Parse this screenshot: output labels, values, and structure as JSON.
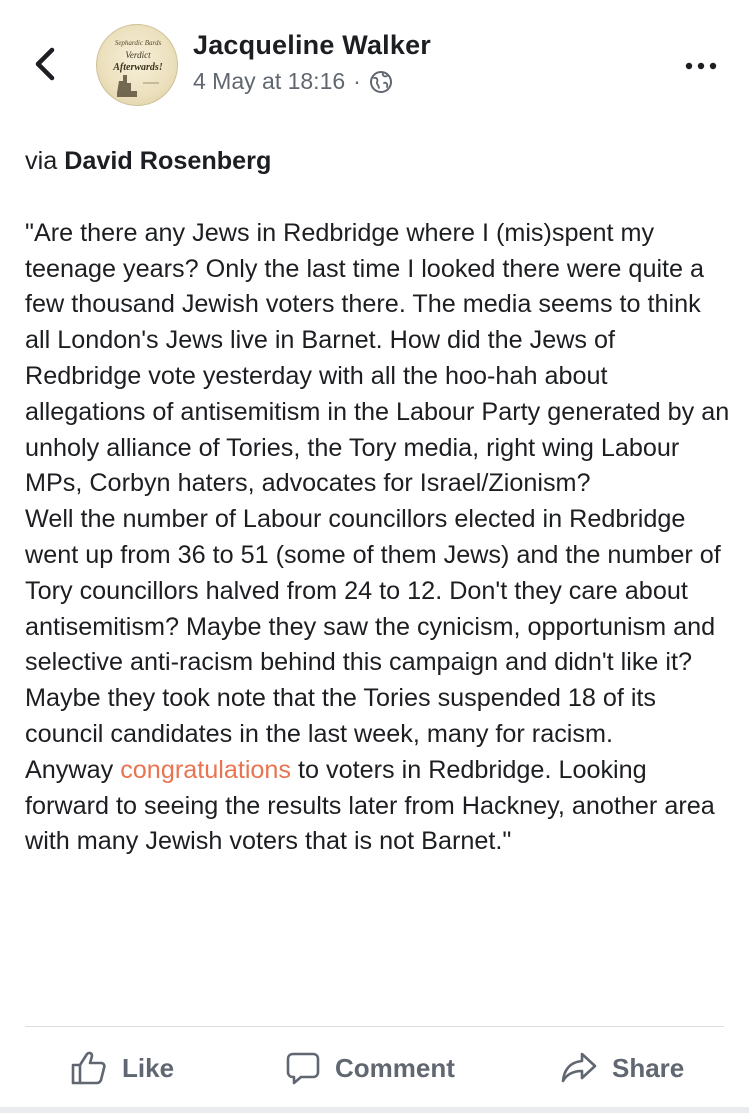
{
  "header": {
    "author": "Jacqueline Walker",
    "timestamp": "4 May at 18:16",
    "separator": "·",
    "privacy_icon": "globe-icon",
    "back_icon": "chevron-left-icon",
    "more_icon": "more-horizontal-icon",
    "avatar_text": [
      "Sephardic Bards",
      "Verdict",
      "Afterwards!"
    ]
  },
  "post": {
    "via_prefix": "via",
    "via_name": "David Rosenberg",
    "body_part1": "\"Are there any Jews in Redbridge where I (mis)spent my teenage years? Only the last time I looked there were quite a few thousand Jewish voters there. The media seems to think all London's Jews live in Barnet. How did the Jews of Redbridge vote yesterday with all the hoo-hah about allegations of antisemitism in the Labour Party generated by an unholy alliance of Tories, the Tory media, right wing Labour MPs, Corbyn haters, advocates for Israel/Zionism?\nWell the number of Labour councillors elected in Redbridge went up from 36 to 51 (some of them Jews) and the number of Tory councillors halved from 24 to 12. Don't they care about antisemitism? Maybe they saw the cynicism, opportunism and selective anti-racism behind this campaign and didn't like it? Maybe they took note that the Tories suspended 18 of its council candidates in the last week, many for racism.\nAnyway ",
    "highlight": "congratulations",
    "body_part2": " to voters in Redbridge. Looking forward to seeing the results later from Hackney, another area with many Jewish voters that is not Barnet.\""
  },
  "actions": {
    "like_label": "Like",
    "comment_label": "Comment",
    "share_label": "Share"
  },
  "colors": {
    "highlight": "#e9744f",
    "meta_gray": "#606770",
    "text": "#1c1e21"
  }
}
